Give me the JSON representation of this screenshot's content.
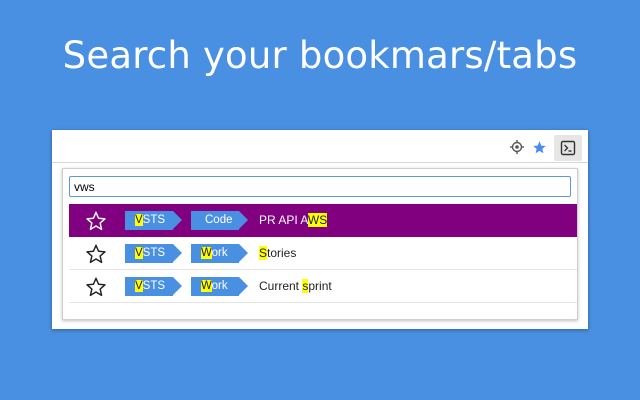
{
  "headline": "Search your bookmars/tabs",
  "toolbar": {
    "icons": [
      "target-icon",
      "bookmark-star-icon",
      "extension-terminal-icon"
    ],
    "star_color": "#4a8af4"
  },
  "search": {
    "value": "vws"
  },
  "results": [
    {
      "selected": true,
      "tag1": {
        "hl": "V",
        "rest": "STS"
      },
      "tag2": {
        "pre": "",
        "hl": "",
        "rest": "Code"
      },
      "title": {
        "pre": "PR API A",
        "hl": "WS",
        "post": ""
      }
    },
    {
      "selected": false,
      "tag1": {
        "hl": "V",
        "rest": "STS"
      },
      "tag2": {
        "pre": "",
        "hl": "W",
        "rest": "ork"
      },
      "title": {
        "pre": "",
        "hl": "S",
        "post": "tories"
      }
    },
    {
      "selected": false,
      "tag1": {
        "hl": "V",
        "rest": "STS"
      },
      "tag2": {
        "pre": "",
        "hl": "W",
        "rest": "ork"
      },
      "title": {
        "pre": "Current ",
        "hl": "s",
        "post": "print"
      }
    }
  ],
  "colors": {
    "background": "#4a90e2",
    "selected_row": "#800080",
    "tag": "#4a90e2",
    "highlight": "#ffff00"
  }
}
